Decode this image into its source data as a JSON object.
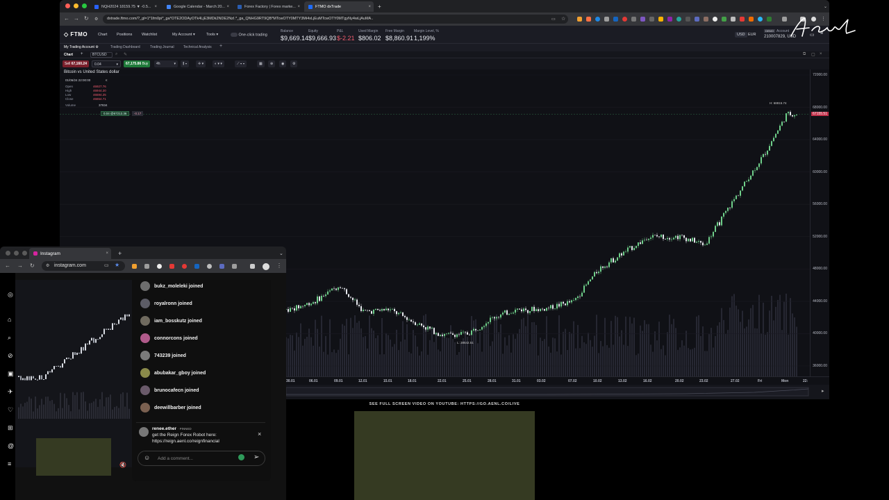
{
  "main_browser": {
    "tabs": [
      {
        "title": "NQH2024 18159.75 ▼ -0.5...",
        "color": "#2962ff"
      },
      {
        "title": "Google Calendar - March 20...",
        "color": "#4285f4"
      },
      {
        "title": "Forex Factory | Forex marke...",
        "color": "#2a5db0"
      },
      {
        "title": "FTMO dxTrade",
        "color": "#1e6cff"
      }
    ],
    "address": "dxtrade.ftmo.com/?_gl=1*1fm0pi*_ga*OTE2ODAyOTk4LjE3MDk2NDE2NzI.*_ga_QNHG9RT9QB*MTcwOTY0MTY3Mi4xLjEuMTcwOTY0MTgyNy4wLjAuMA.."
  },
  "ftmo": {
    "logo": "FTMO",
    "nav": [
      "Chart",
      "Positions",
      "Watchlist",
      "My Account",
      "Tools"
    ],
    "one_click": "One-click trading",
    "stats": [
      {
        "label": "Balance",
        "value": "$9,669.14",
        "color": "#e8eaf0"
      },
      {
        "label": "Equity",
        "value": "$9,666.93",
        "color": "#e8eaf0"
      },
      {
        "label": "P&L",
        "value": "$-2.21",
        "color": "#f25c6e"
      },
      {
        "label": "Used Margin",
        "value": "$806.02",
        "color": "#e8eaf0"
      },
      {
        "label": "Free Margin",
        "value": "$8,860.91",
        "color": "#e8eaf0"
      },
      {
        "label": "Margin Level, %",
        "value": "1,199%",
        "color": "#e8eaf0"
      }
    ],
    "currencies": [
      "USD",
      "EUR"
    ],
    "account_label": "Account",
    "account_value": "210007829, USD",
    "account_badge": "DEMO",
    "subtabs": [
      "My Trading Account",
      "Trading Dashboard",
      "Trading Journal",
      "Technical Analysis"
    ],
    "chart_tab": "Chart",
    "symbol": "BTCUSD",
    "sell_label": "Sell",
    "sell_price": "67,160.24",
    "quantity": "0.04",
    "buy_label": "Buy",
    "buy_price": "67,175.86",
    "timeframe": "4h",
    "chart_title": "Bitcoin vs United States dollar",
    "ohlc": {
      "date": "01/06/24 22:00:00",
      "open_label": "Open",
      "open": "46927.76",
      "high_label": "High",
      "high": "46944.20",
      "low_label": "Low",
      "low": "46594.25",
      "close_label": "Close",
      "close": "46654.71",
      "volume_label": "Volume",
      "volume": "37834"
    },
    "position_tag": "0.04 @67213.36",
    "position_pnl": "-0.17",
    "high_marker": "H: 68815.74",
    "low_marker": "L: 38542.51",
    "current_price": "67155.51",
    "price_ticks": [
      "72000.00",
      "68000.00",
      "64000.00",
      "60000.00",
      "56000.00",
      "52000.00",
      "48000.00",
      "44000.00",
      "40000.00",
      "36000.00"
    ],
    "time_ticks": [
      "30.01",
      "06.01",
      "09.01",
      "12.01",
      "15.01",
      "18.01",
      "22.01",
      "25.01",
      "28.01",
      "31.01",
      "03.02",
      "07.02",
      "10.02",
      "13.02",
      "16.02",
      "20.02",
      "23.02",
      "27.02",
      "Fri",
      "Mon",
      "22:"
    ]
  },
  "chart_data": {
    "type": "candlestick",
    "title": "Bitcoin vs United States dollar",
    "symbol": "BTCUSD",
    "timeframe": "4h",
    "ylim": [
      36000,
      72000
    ],
    "x_labels": [
      "30.01",
      "06.01",
      "09.01",
      "12.01",
      "15.01",
      "18.01",
      "22.01",
      "25.01",
      "28.01",
      "31.01",
      "03.02",
      "07.02",
      "10.02",
      "13.02",
      "16.02",
      "20.02",
      "23.02",
      "27.02",
      "Fri",
      "Mon"
    ],
    "close_path": [
      {
        "x": "30.01",
        "y": 43000
      },
      {
        "x": "06.01",
        "y": 44000
      },
      {
        "x": "09.01",
        "y": 46000
      },
      {
        "x": "12.01",
        "y": 42700
      },
      {
        "x": "15.01",
        "y": 43000
      },
      {
        "x": "18.01",
        "y": 41500
      },
      {
        "x": "22.01",
        "y": 39800
      },
      {
        "x": "25.01",
        "y": 40000
      },
      {
        "x": "28.01",
        "y": 42000
      },
      {
        "x": "31.01",
        "y": 43000
      },
      {
        "x": "03.02",
        "y": 43000
      },
      {
        "x": "07.02",
        "y": 44000
      },
      {
        "x": "10.02",
        "y": 48000
      },
      {
        "x": "13.02",
        "y": 50000
      },
      {
        "x": "16.02",
        "y": 52000
      },
      {
        "x": "20.02",
        "y": 52000
      },
      {
        "x": "23.02",
        "y": 51000
      },
      {
        "x": "27.02",
        "y": 57000
      },
      {
        "x": "Fri",
        "y": 62000
      },
      {
        "x": "Mon",
        "y": 67155.51
      }
    ],
    "high_marker": 68815.74,
    "low_marker": 38542.51
  },
  "youtube_banner": "SEE FULL SCREEN VIDEO ON YOUTUBE: HTTPS://GO.AENL.CO/LIVE",
  "instagram": {
    "tab_title": "Instagram",
    "address": "instagram.com",
    "joins": [
      "bukz_moleleki joined",
      "royalronn joined",
      "iam_bosskutz joined",
      "connorcons joined",
      "743239 joined",
      "abubakar_gboy joined",
      "brunocafecn joined",
      "deewillbarber joined"
    ],
    "pinned_user": "renee.ether",
    "pinned_tag": "· PINNED",
    "pinned_text_1": "get the Reign Forex Robot here:",
    "pinned_text_2": "https://reign.aenl.co/reignfinancial",
    "comment_placeholder": "Add a comment..."
  },
  "signature_text": "Aenl"
}
